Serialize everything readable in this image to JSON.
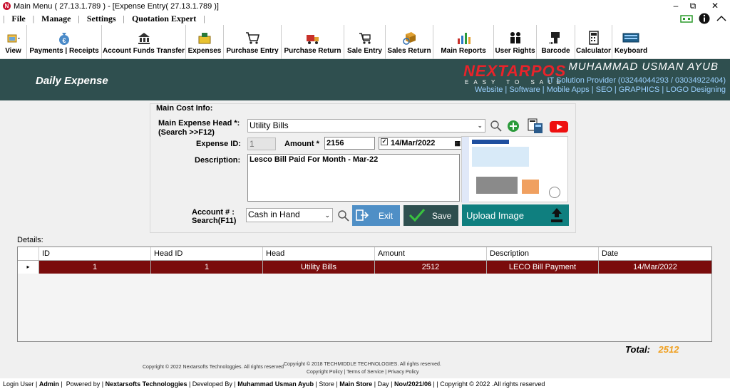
{
  "window": {
    "title": "Main Menu ( 27.13.1.789 ) - [Expense Entry( 27.13.1.789 )]",
    "minimize": "–",
    "restore": "⧉",
    "close": "✕"
  },
  "menu": {
    "items": [
      "File",
      "Manage",
      "Settings",
      "Quotation Expert"
    ]
  },
  "toolbar": {
    "items": [
      {
        "label": "View",
        "icon": "view-icon"
      },
      {
        "label": "Payments | Receipts",
        "icon": "money-bag-icon"
      },
      {
        "label": "Account Funds Transfer",
        "icon": "bank-transfer-icon"
      },
      {
        "label": "Expenses",
        "icon": "expenses-icon"
      },
      {
        "label": "Purchase Entry",
        "icon": "cart-icon"
      },
      {
        "label": "Purchase Return",
        "icon": "truck-return-icon"
      },
      {
        "label": "Sale Entry",
        "icon": "trolley-icon"
      },
      {
        "label": "Sales Return",
        "icon": "box-return-icon"
      },
      {
        "label": "Main Reports",
        "icon": "report-chart-icon"
      },
      {
        "label": "User Rights",
        "icon": "users-icon"
      },
      {
        "label": "Barcode",
        "icon": "barcode-scanner-icon"
      },
      {
        "label": "Calculator",
        "icon": "calculator-icon"
      },
      {
        "label": "Keyboard",
        "icon": "keyboard-icon"
      }
    ]
  },
  "banner": {
    "title": "Daily Expense",
    "logo": "NEXTARPOS",
    "logo_sub": "EASY TO SALE",
    "owner": "MUHAMMAD USMAN AYUB",
    "tagline": "IT Solution Provider (03244044293 / 03034922404)",
    "links": "Website | Software | Mobile Apps | SEO | GRAPHICS | LOGO Designing"
  },
  "form": {
    "section_title": "Main Cost Info:",
    "expense_head_label": "Main Expense Head *:",
    "expense_head_hint": "(Search >>F12)",
    "expense_head_value": "Utility Bills",
    "expense_id_label": "Expense ID:",
    "expense_id_value": "1",
    "amount_label": "Amount *",
    "amount_value": "2156",
    "date_value": "14/Mar/2022",
    "description_label": "Description:",
    "description_value": "Lesco Bill Paid For Month - Mar-22",
    "account_label": "Account # :",
    "account_hint": "Search(F11)",
    "account_value": "Cash in Hand",
    "exit_label": "Exit",
    "save_label": "Save",
    "upload_label": "Upload Image"
  },
  "details": {
    "label": "Details:",
    "columns": [
      "ID",
      "Head ID",
      "Head",
      "Amount",
      "Description",
      "Date"
    ],
    "rows": [
      [
        "1",
        "1",
        "Utility Bills",
        "2512",
        "LECO Bill Payment",
        "14/Mar/2022"
      ]
    ]
  },
  "total": {
    "label": "Total:",
    "value": "2512"
  },
  "footer": {
    "copyright_left": "Copyright © 2022 Nextarsofts Technologgies. All rights reserved",
    "copyright_techmiddle": "Copyright © 2018 TECHMIDDLE TECHNOLOGIES. All rights reserved.",
    "policy": "Copyright Policy | Terms of Service | Privacy Policy"
  },
  "status": {
    "login_user_label": "Login User",
    "login_user": "Admin",
    "powered_label": "Powered by",
    "powered": "Nextarsofts Technologgies",
    "developed_label": "Developed By",
    "developed": "Muhammad Usman Ayub",
    "store_label": "Store",
    "store": "Main Store",
    "day_label": "Day",
    "day": "Nov/2021/06",
    "copyright": "Copyright © 2022 .All rights reserved"
  },
  "colors": {
    "banner_bg": "#2f4f4f",
    "selected_row": "#7a0c0c",
    "exit_button": "#4f8fc6",
    "save_button": "#2e4f4f",
    "upload_button": "#0f7f7f",
    "total_value": "#f0a020"
  }
}
